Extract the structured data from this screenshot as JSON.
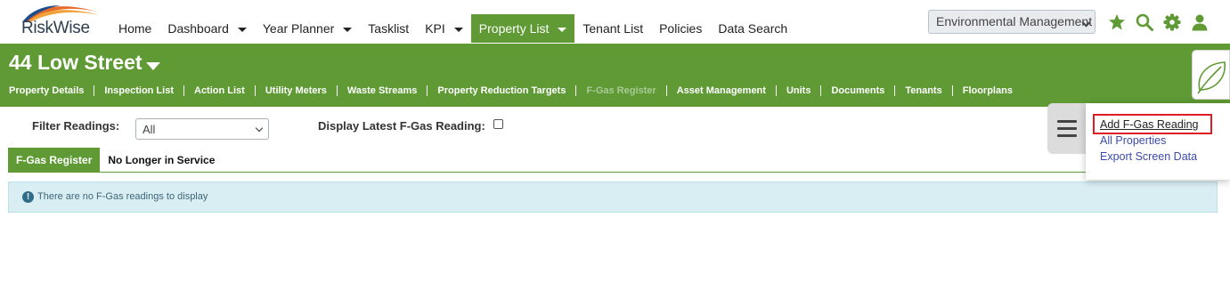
{
  "app": {
    "logo_text": "RiskWise"
  },
  "nav": {
    "items": [
      {
        "label": "Home",
        "dropdown": false,
        "active": false
      },
      {
        "label": "Dashboard",
        "dropdown": true,
        "active": false
      },
      {
        "label": "Year Planner",
        "dropdown": true,
        "active": false
      },
      {
        "label": "Tasklist",
        "dropdown": false,
        "active": false
      },
      {
        "label": "KPI",
        "dropdown": true,
        "active": false
      },
      {
        "label": "Property List",
        "dropdown": true,
        "active": true
      },
      {
        "label": "Tenant List",
        "dropdown": false,
        "active": false
      },
      {
        "label": "Policies",
        "dropdown": false,
        "active": false
      },
      {
        "label": "Data Search",
        "dropdown": false,
        "active": false
      }
    ],
    "module_select": "Environmental Management",
    "icons": [
      "star-icon",
      "search-icon",
      "gear-icon",
      "user-icon"
    ]
  },
  "property": {
    "title": "44 Low Street",
    "subnav": [
      {
        "label": "Property Details",
        "disabled": false
      },
      {
        "label": "Inspection List",
        "disabled": false
      },
      {
        "label": "Action List",
        "disabled": false
      },
      {
        "label": "Utility Meters",
        "disabled": false
      },
      {
        "label": "Waste Streams",
        "disabled": false
      },
      {
        "label": "Property Reduction Targets",
        "disabled": false
      },
      {
        "label": "F-Gas Register",
        "disabled": true
      },
      {
        "label": "Asset Management",
        "disabled": false
      },
      {
        "label": "Units",
        "disabled": false
      },
      {
        "label": "Documents",
        "disabled": false
      },
      {
        "label": "Tenants",
        "disabled": false
      },
      {
        "label": "Floorplans",
        "disabled": false
      }
    ]
  },
  "filters": {
    "readings_label": "Filter Readings:",
    "readings_value": "All",
    "latest_label": "Display Latest F-Gas Reading:",
    "latest_checked": false
  },
  "tabs": [
    {
      "label": "F-Gas Register",
      "active": true
    },
    {
      "label": "No Longer in Service",
      "active": false
    }
  ],
  "alert": {
    "icon": "!",
    "text": "There are no F-Gas readings to display"
  },
  "side_menu": {
    "items": [
      {
        "label": "Add F-Gas Reading"
      },
      {
        "label": "All Properties"
      },
      {
        "label": "Export Screen Data"
      }
    ]
  },
  "colors": {
    "brand_green": "#5f9a35",
    "link_blue": "#3b4ba8",
    "highlight_red": "#e01b24"
  }
}
